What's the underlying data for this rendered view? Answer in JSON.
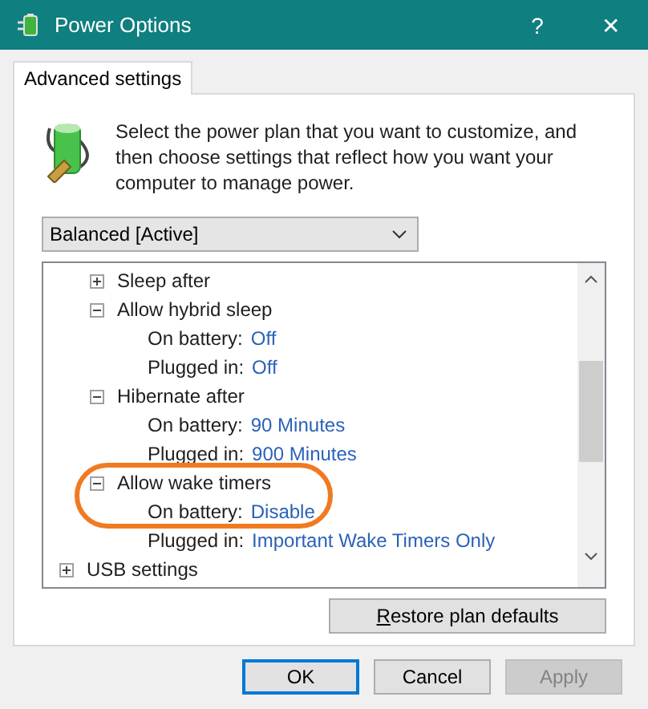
{
  "window": {
    "title": "Power Options",
    "help": "?",
    "close": "✕"
  },
  "tabs": [
    {
      "label": "Advanced settings",
      "selected": true
    }
  ],
  "intro": "Select the power plan that you want to customize, and then choose settings that reflect how you want your computer to manage power.",
  "plan_dropdown": {
    "value": "Balanced [Active]"
  },
  "tree": {
    "items": [
      {
        "children": [
          {
            "label": "Sleep after",
            "expanded": false
          },
          {
            "label": "Allow hybrid sleep",
            "expanded": true,
            "children": [
              {
                "label": "On battery:",
                "value": "Off"
              },
              {
                "label": "Plugged in:",
                "value": "Off"
              }
            ]
          },
          {
            "label": "Hibernate after",
            "expanded": true,
            "children": [
              {
                "label": "On battery:",
                "value": "90 Minutes"
              },
              {
                "label": "Plugged in:",
                "value": "900 Minutes"
              }
            ]
          },
          {
            "label": "Allow wake timers",
            "expanded": true,
            "children": [
              {
                "label": "On battery:",
                "value": "Disable"
              },
              {
                "label": "Plugged in:",
                "value": "Important Wake Timers Only"
              }
            ]
          }
        ]
      },
      {
        "label": "USB settings",
        "expanded": false
      }
    ]
  },
  "restore_button": {
    "label": "Restore plan defaults"
  },
  "buttons": [
    {
      "label": "OK",
      "kind": "default",
      "disabled": false
    },
    {
      "label": "Cancel",
      "kind": "normal",
      "disabled": false
    },
    {
      "label": "Apply",
      "kind": "normal",
      "disabled": true
    }
  ]
}
